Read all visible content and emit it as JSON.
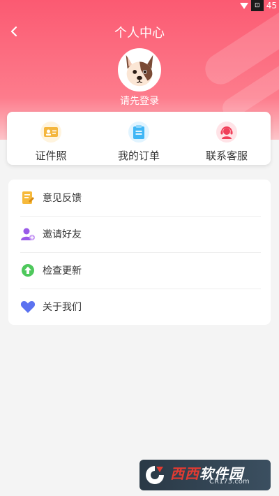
{
  "status_bar": {
    "time": "45",
    "record_glyph": "⊡"
  },
  "header": {
    "title": "个人中心",
    "login_text": "请先登录",
    "gradient": [
      "#fb5a72",
      "#fdc4c9"
    ]
  },
  "quick_actions": [
    {
      "label": "证件照",
      "icon": "id-card-icon",
      "color": "#f4b63d"
    },
    {
      "label": "我的订单",
      "icon": "order-clipboard-icon",
      "color": "#3fb6f5"
    },
    {
      "label": "联系客服",
      "icon": "customer-service-icon",
      "color": "#f0405a"
    }
  ],
  "menu": [
    {
      "label": "意见反馈",
      "icon": "feedback-icon",
      "color": "#f6b93b"
    },
    {
      "label": "邀请好友",
      "icon": "invite-friend-icon",
      "color": "#9a5be8"
    },
    {
      "label": "检查更新",
      "icon": "update-icon",
      "color": "#4ec85c"
    },
    {
      "label": "关于我们",
      "icon": "heart-icon",
      "color": "#5b72f0"
    }
  ],
  "watermark": {
    "name_part1": "西西",
    "name_part2": "软件园",
    "site": "CR173.com"
  }
}
